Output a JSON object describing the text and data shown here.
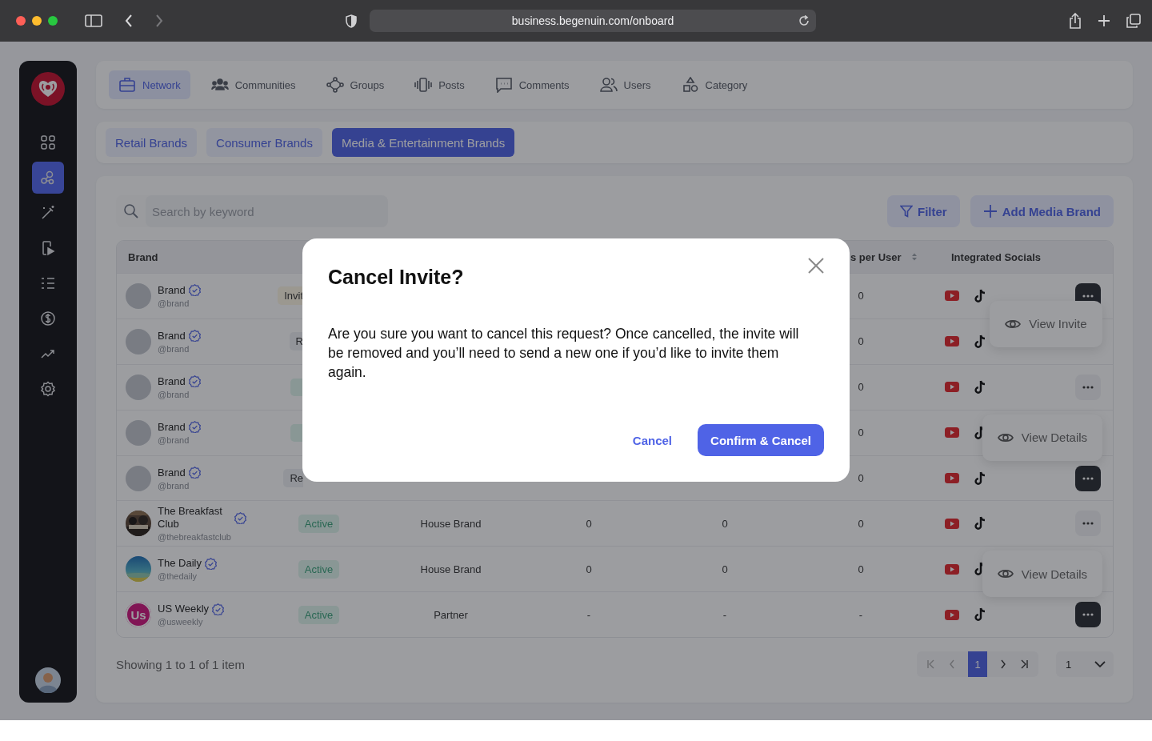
{
  "browser": {
    "url": "business.begenuin.com/onboard"
  },
  "sidebar": {
    "items": [
      {
        "kind": "grid",
        "selected": false
      },
      {
        "kind": "network",
        "selected": true
      },
      {
        "kind": "wand",
        "selected": false
      },
      {
        "kind": "video",
        "selected": false
      },
      {
        "kind": "checklist",
        "selected": false
      },
      {
        "kind": "dollar",
        "selected": false
      },
      {
        "kind": "trend",
        "selected": false
      },
      {
        "kind": "settings",
        "selected": false
      }
    ]
  },
  "nav_tabs": [
    {
      "label": "Network",
      "kind": "briefcase",
      "selected": true
    },
    {
      "label": "Communities",
      "kind": "people",
      "selected": false
    },
    {
      "label": "Groups",
      "kind": "nodes",
      "selected": false
    },
    {
      "label": "Posts",
      "kind": "phone",
      "selected": false
    },
    {
      "label": "Comments",
      "kind": "comment",
      "selected": false
    },
    {
      "label": "Users",
      "kind": "users",
      "selected": false
    },
    {
      "label": "Category",
      "kind": "shapes",
      "selected": false
    }
  ],
  "brand_tabs": [
    {
      "label": "Retail Brands",
      "selected": false
    },
    {
      "label": "Consumer Brands",
      "selected": false
    },
    {
      "label": "Media & Entertainment Brands",
      "selected": true
    }
  ],
  "search": {
    "placeholder": "Search by keyword"
  },
  "actions": [
    {
      "label": "Filter",
      "kind": "filter"
    },
    {
      "label": "Add Media Brand",
      "kind": "add"
    }
  ],
  "table": {
    "columns": {
      "brand": {
        "label": "Brand"
      },
      "column_6": {
        "label": "s per User",
        "sortable": true
      },
      "socials": {
        "label": "Integrated Socials"
      }
    },
    "rows": [
      {
        "name": "Brand",
        "handle": "@brand",
        "avatar": {
          "kind": "placeholder"
        },
        "verified": true,
        "status": {
          "label": "Invit",
          "kind": "invited"
        },
        "column_6": "0",
        "socials": [
          {
            "kind": "youtube"
          },
          {
            "kind": "tiktok"
          }
        ],
        "actions": {
          "open": true,
          "menu": {
            "label": "View Invite",
            "kind": "dropdown"
          }
        }
      },
      {
        "name": "Brand",
        "handle": "@brand",
        "avatar": {
          "kind": "placeholder"
        },
        "verified": true,
        "status": {
          "label": "R",
          "kind": "neutral"
        },
        "column_6": "0",
        "socials": [
          {
            "kind": "youtube"
          },
          {
            "kind": "tiktok"
          }
        ]
      },
      {
        "name": "Brand",
        "handle": "@brand",
        "avatar": {
          "kind": "placeholder"
        },
        "verified": true,
        "status": {
          "kind": "active"
        },
        "column_6": "0",
        "socials": [
          {
            "kind": "youtube"
          },
          {
            "kind": "tiktok"
          }
        ],
        "actions": {
          "open": false
        }
      },
      {
        "name": "Brand",
        "handle": "@brand",
        "avatar": {
          "kind": "placeholder"
        },
        "verified": true,
        "status": {
          "kind": "active"
        },
        "column_6": "0",
        "socials": [
          {
            "kind": "youtube"
          },
          {
            "kind": "tiktok"
          }
        ]
      },
      {
        "name": "Brand",
        "handle": "@brand",
        "avatar": {
          "kind": "placeholder"
        },
        "verified": true,
        "status": {
          "label": "Re",
          "kind": "neutral"
        },
        "column_6": "0",
        "socials": [
          {
            "kind": "youtube"
          },
          {
            "kind": "tiktok"
          }
        ],
        "actions": {
          "open": true,
          "menu": {
            "label": "View Details",
            "kind": "dropup"
          }
        }
      },
      {
        "name": "The Breakfast Club",
        "handle": "@thebreakfastclub",
        "avatar": {
          "kind": "picture"
        },
        "verified": true,
        "status": {
          "label": "Active",
          "kind": "active"
        },
        "type": "House Brand",
        "column_4": "0",
        "column_5": "0",
        "column_6": "0",
        "socials": [
          {
            "kind": "youtube"
          },
          {
            "kind": "tiktok"
          }
        ],
        "actions": {
          "open": false
        }
      },
      {
        "name": "The Daily",
        "handle": "@thedaily",
        "avatar": {
          "kind": "picture"
        },
        "verified": true,
        "status": {
          "label": "Active",
          "kind": "active"
        },
        "type": "House Brand",
        "column_4": "0",
        "column_5": "0",
        "column_6": "0",
        "socials": [
          {
            "kind": "youtube"
          },
          {
            "kind": "tiktok"
          }
        ]
      },
      {
        "name": "US Weekly",
        "handle": "@usweekly",
        "avatar": {
          "kind": "logo",
          "text": "Us"
        },
        "verified": true,
        "status": {
          "label": "Active",
          "kind": "active"
        },
        "type": "Partner",
        "column_4": "-",
        "column_5": "-",
        "column_6": "-",
        "socials": [
          {
            "kind": "youtube"
          },
          {
            "kind": "tiktok"
          }
        ],
        "actions": {
          "open": true,
          "menu": {
            "label": "View Details",
            "kind": "dropup"
          }
        }
      }
    ]
  },
  "footer": {
    "summary": "Showing 1 to 1 of 1 item",
    "pages": [
      {
        "label": "1",
        "selected": true
      }
    ],
    "page_size": "1"
  },
  "modal": {
    "title": "Cancel Invite?",
    "message": "Are you sure you want to cancel this request? Once cancelled, the invite will be removed and you’ll need to send a new one if you’d like to invite them again.",
    "buttons": [
      {
        "label": "Cancel",
        "kind": "text"
      },
      {
        "label": "Confirm & Cancel",
        "kind": "primary"
      }
    ]
  }
}
